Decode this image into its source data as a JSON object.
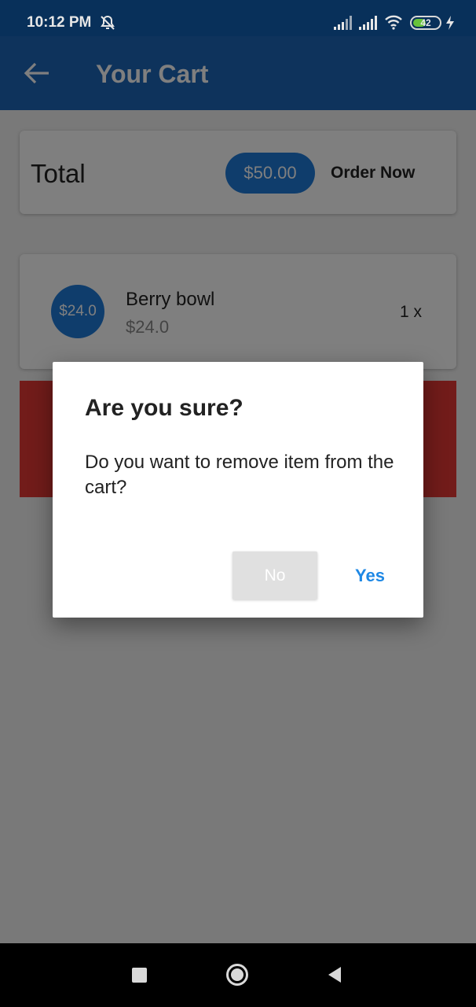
{
  "status_bar": {
    "time": "10:12 PM",
    "battery": "42",
    "icons": [
      "do-not-disturb-icon",
      "signal-icon",
      "signal-icon",
      "wifi-icon",
      "battery-icon",
      "charging-icon"
    ]
  },
  "app_bar": {
    "title": "Your Cart",
    "back_icon": "arrow-back-icon"
  },
  "total_card": {
    "label": "Total",
    "amount": "$50.00",
    "order_label": "Order Now"
  },
  "item": {
    "avatar_text": "$24.0",
    "name": "Berry bowl",
    "price": "$24.0",
    "quantity": "1 x"
  },
  "dialog": {
    "title": "Are you sure?",
    "message": "Do you want to remove item from the cart?",
    "no_label": "No",
    "yes_label": "Yes"
  },
  "colors": {
    "primary": "#1c66b8",
    "accent": "#1e7ad9",
    "dismiss_background": "#e53935",
    "link": "#1e88e5"
  },
  "nav_bar": {
    "icons": [
      "recents-icon",
      "home-icon",
      "back-icon"
    ]
  }
}
